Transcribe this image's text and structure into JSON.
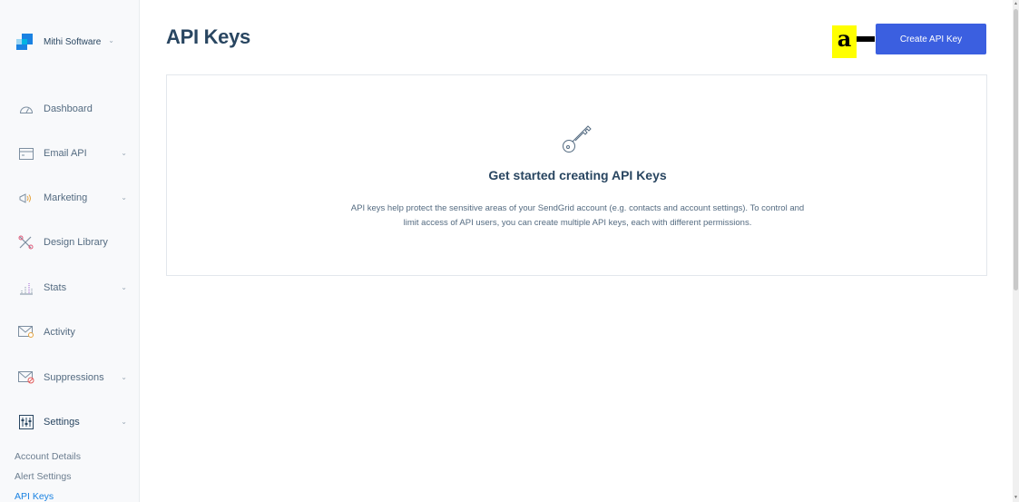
{
  "account": {
    "name": "Mithi Software",
    "chevron": "chevron-down-icon"
  },
  "sidebar": {
    "items": [
      {
        "label": "Dashboard",
        "icon": "dashboard-gauge-icon",
        "has_chevron": false
      },
      {
        "label": "Email API",
        "icon": "email-api-icon",
        "has_chevron": true
      },
      {
        "label": "Marketing",
        "icon": "megaphone-icon",
        "has_chevron": true
      },
      {
        "label": "Design Library",
        "icon": "design-library-icon",
        "has_chevron": false
      },
      {
        "label": "Stats",
        "icon": "stats-icon",
        "has_chevron": true
      },
      {
        "label": "Activity",
        "icon": "activity-envelope-icon",
        "has_chevron": false
      },
      {
        "label": "Suppressions",
        "icon": "suppressions-envelope-icon",
        "has_chevron": true
      },
      {
        "label": "Settings",
        "icon": "settings-sliders-icon",
        "has_chevron": true
      }
    ],
    "subitems": [
      {
        "label": "Account Details"
      },
      {
        "label": "Alert Settings"
      },
      {
        "label": "API Keys"
      }
    ]
  },
  "page": {
    "title": "API Keys"
  },
  "annotation": {
    "label": "a"
  },
  "actions": {
    "create_label": "Create API Key"
  },
  "empty_state": {
    "icon": "key-icon",
    "title": "Get started creating API Keys",
    "line1": "API keys help protect the sensitive areas of your SendGrid account (e.g. contacts and account settings). To control and",
    "line2": "limit access of API users, you can create multiple API keys, each with different permissions."
  },
  "colors": {
    "primary_button": "#3b5fe0",
    "title": "#294661",
    "annotation_badge": "#ffff00",
    "active_subnav": "#1a82e2"
  }
}
